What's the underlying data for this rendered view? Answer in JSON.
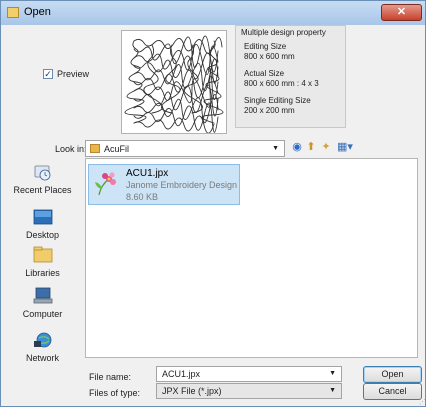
{
  "window": {
    "title": "Open",
    "close_glyph": "✕"
  },
  "preview": {
    "checked": true,
    "label": "Preview"
  },
  "property": {
    "heading": "Multiple design property",
    "editing_label": "Editing Size",
    "editing_value": "800 x  600 mm",
    "actual_label": "Actual Size",
    "actual_value": "800 x  600 mm : 4 x 3",
    "single_label": "Single Editing Size",
    "single_value": "200 x  200 mm"
  },
  "look_in": {
    "label": "Look in:",
    "value": "AcuFil"
  },
  "places": [
    {
      "label": "Recent Places",
      "icon": "recent-places-icon"
    },
    {
      "label": "Desktop",
      "icon": "desktop-icon"
    },
    {
      "label": "Libraries",
      "icon": "libraries-icon"
    },
    {
      "label": "Computer",
      "icon": "computer-icon"
    },
    {
      "label": "Network",
      "icon": "network-icon"
    }
  ],
  "files": [
    {
      "name": "ACU1.jpx",
      "type": "Janome Embroidery Design",
      "size": "8.60 KB",
      "selected": true
    }
  ],
  "file_name": {
    "label": "File name:",
    "value": "ACU1.jpx"
  },
  "file_type": {
    "label": "Files of type:",
    "value": "JPX File (*.jpx)"
  },
  "buttons": {
    "open": "Open",
    "cancel": "Cancel"
  },
  "colors": {
    "titlebar": "#b9d1ee",
    "close": "#c7432f",
    "selection": "#cde4f7",
    "folder": "#e8b64c"
  }
}
